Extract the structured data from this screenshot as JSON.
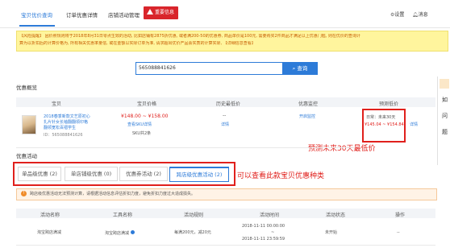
{
  "nav": {
    "tabs": [
      "宝贝优价查询",
      "订单优惠详情",
      "店铺活动管理"
    ],
    "badge": "重要信息",
    "settings": "设置",
    "messages": "消息"
  },
  "notice": {
    "line1": "【风险提醒】 因价照规则将于2018年8月31日零点生效的活动, 比如店铺有2875折优惠, 或者满200-50的优惠券, 商品单价是100元, 需要购买2件商品才满足以上优惠门槛, 则在优价的查询计",
    "line2": "算为以折扣后的计算价格为, 所有相关优惠率量信, 或在金额以实际订单为准, 请求超出优价产品会实质的计算实际, 【详细信息查看】"
  },
  "search": {
    "value": "565088841626",
    "button": "查询"
  },
  "overview": {
    "title": "优惠概览",
    "headers": [
      "宝贝",
      "宝贝价格",
      "历史最低价",
      "优惠监控",
      "预测低价"
    ],
    "item": {
      "title_line1": "2018春季新款文艺原初心",
      "title_line2": "扎片针女长袖翻翻领印格",
      "title_line3": "翻领宽松百褶学生",
      "id": "ID：565088841626",
      "price": "¥148.00 ~ ¥158.00",
      "price_link": "查看SKU详情",
      "stock": "SKU共2条",
      "history": "--",
      "history_link": "详情",
      "monitor_link": "开启监控",
      "forecast_label": "日常：未来30天",
      "forecast_price": "¥145.04 ~ ¥154.84",
      "forecast_link": "详情"
    }
  },
  "annotation1": "预测未来30天最低价",
  "activities": {
    "title": "优惠活动",
    "subtabs": [
      "单品级优惠 (2)",
      "单店铺级优惠 (0)",
      "优惠券活动 (2)",
      "跨店级优惠活动 (2)"
    ],
    "annotation": "可以查看此款宝贝优惠种类",
    "alert": "跨店级优惠活动无法预测计算，请根据活动信息评估折扣力度，避免折扣力度过大造成损失。",
    "headers": [
      "活动名称",
      "工具名称",
      "活动规则",
      "活动时间",
      "活动状态",
      "操作"
    ],
    "rows": [
      {
        "name": "淘宝跨店满减",
        "tool": "淘宝跨店满减",
        "rule": "每满200元，减20元",
        "time_start": "2018-11-11 00:00:00",
        "time_sep": "~",
        "time_end": "2018-11-11 23:59:59",
        "status": "未开始",
        "action": "--"
      }
    ]
  },
  "sidebar": {
    "chars": [
      "如",
      "问",
      "题"
    ]
  },
  "colors": {
    "accent": "#2d7bd8",
    "danger": "#e0201c",
    "notice_bg": "#fff59d"
  }
}
